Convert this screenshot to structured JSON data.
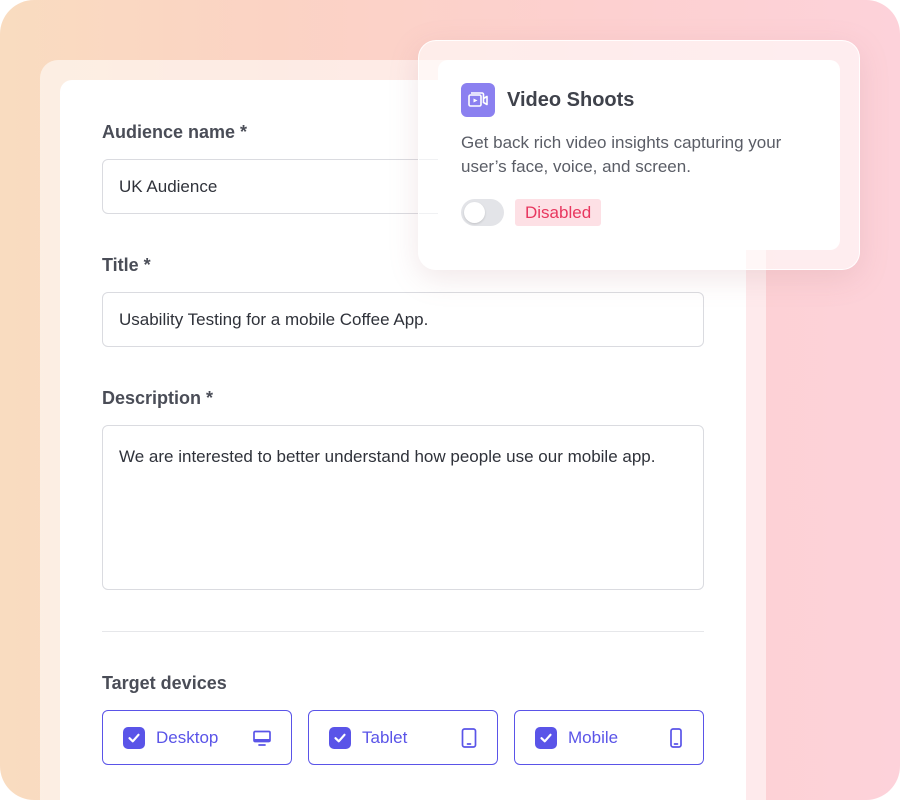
{
  "form": {
    "audience_name": {
      "label": "Audience name *",
      "value": "UK Audience"
    },
    "title": {
      "label": "Title *",
      "value": "Usability Testing for a mobile Coffee App."
    },
    "description": {
      "label": "Description *",
      "value": "We are interested to better understand how people use our mobile app."
    },
    "target_devices": {
      "label": "Target devices",
      "options": [
        {
          "label": "Desktop",
          "checked": true,
          "icon": "desktop-icon"
        },
        {
          "label": "Tablet",
          "checked": true,
          "icon": "tablet-icon"
        },
        {
          "label": "Mobile",
          "checked": true,
          "icon": "mobile-icon"
        }
      ]
    }
  },
  "video_shoots": {
    "icon": "video-icon",
    "title": "Video Shoots",
    "description": "Get back rich video insights capturing your user’s face, voice, and screen.",
    "toggle_enabled": false,
    "status": "Disabled"
  },
  "colors": {
    "accent": "#5a54e8",
    "popup_icon_bg": "#8b80f0",
    "disabled_badge_bg": "#fde0e5",
    "disabled_badge_text": "#e8375f"
  }
}
